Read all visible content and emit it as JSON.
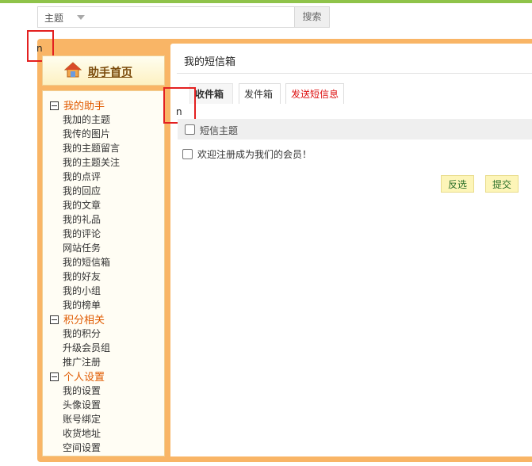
{
  "search": {
    "scope": "主题",
    "button": "搜索"
  },
  "markers": {
    "left_text": "n",
    "main_text": "n"
  },
  "sidebar": {
    "home_label": "助手首页",
    "groups": [
      {
        "title": "我的助手",
        "items": [
          "我加的主题",
          "我传的图片",
          "我的主题留言",
          "我的主题关注",
          "我的点评",
          "我的回应",
          "我的文章",
          "我的礼品",
          "我的评论",
          "网站任务",
          "我的短信箱",
          "我的好友",
          "我的小组",
          "我的榜单"
        ]
      },
      {
        "title": "积分相关",
        "items": [
          "我的积分",
          "升级会员组",
          "推广注册"
        ]
      },
      {
        "title": "个人设置",
        "items": [
          "我的设置",
          "头像设置",
          "账号绑定",
          "收货地址",
          "空间设置"
        ]
      }
    ]
  },
  "main": {
    "title": "我的短信箱",
    "tabs": [
      "收件箱",
      "发件箱",
      "发送短信息"
    ],
    "header_label": "短信主题",
    "messages": [
      "欢迎注册成为我们的会员！"
    ],
    "buttons": {
      "invert": "反选",
      "submit": "提交"
    }
  },
  "colors": {
    "frame": "#f9b566",
    "group_title": "#e05a00",
    "tab_send": "#dd1111",
    "topbar": "#8fc34a"
  }
}
